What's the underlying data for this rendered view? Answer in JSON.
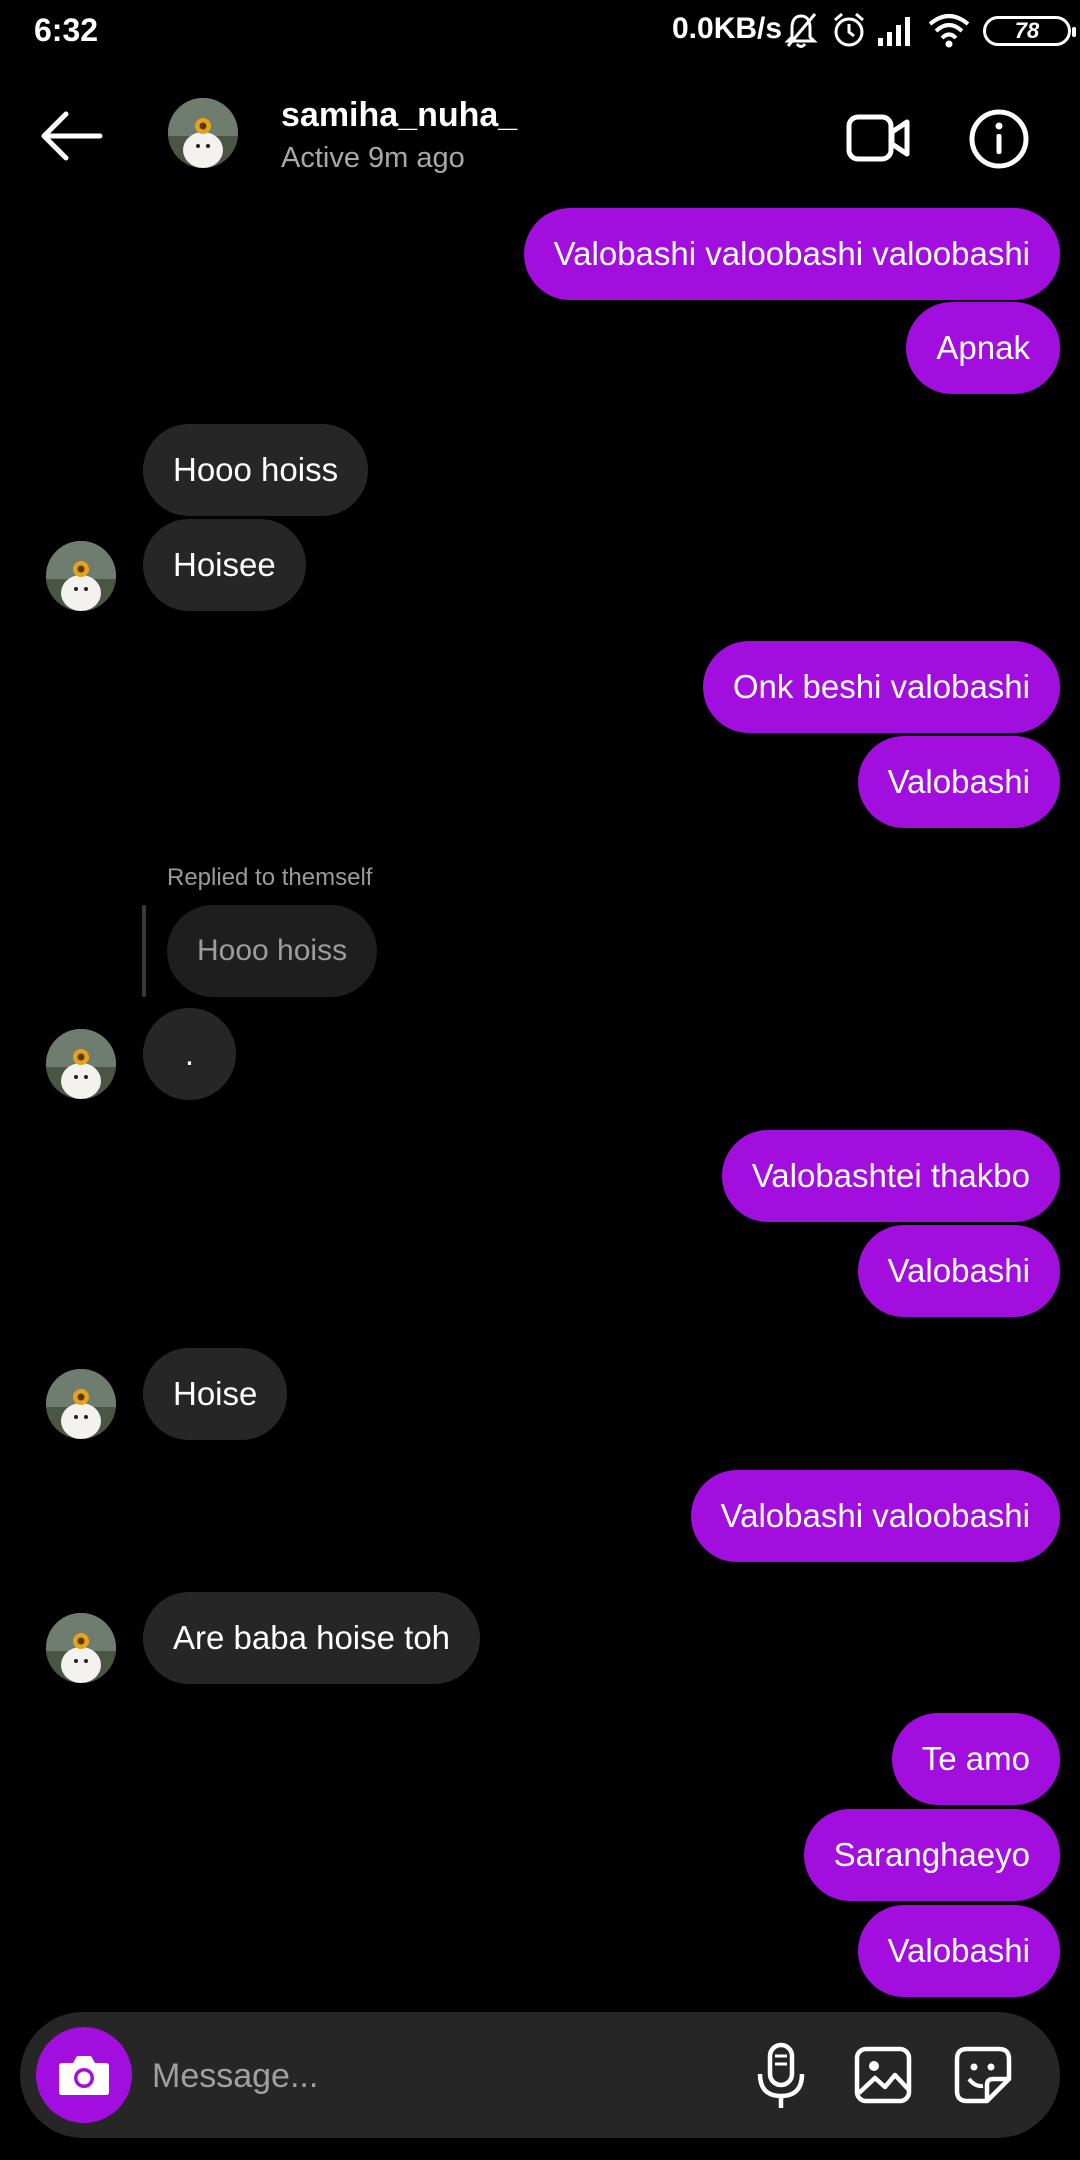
{
  "status_bar": {
    "time": "6:32",
    "net_speed": "0.0KB/s",
    "battery": "78",
    "icons": [
      "mute-bell-icon",
      "alarm-icon",
      "signal-icon",
      "wifi-icon"
    ]
  },
  "header": {
    "name": "samiha_nuha_",
    "status": "Active 9m ago",
    "icons": [
      "back-arrow-icon",
      "video-call-icon",
      "info-icon"
    ]
  },
  "messages": {
    "m1": "Valobashi valoobashi valoobashi",
    "m2": "Apnak",
    "m3": "Hooo hoiss",
    "m4": "Hoisee",
    "m5": "Onk beshi valobashi",
    "m6": "Valobashi",
    "reply_label": "Replied to themself",
    "reply_quote": "Hooo hoiss",
    "m7": ".",
    "m8": "Valobashtei thakbo",
    "m9": "Valobashi",
    "m10": "Hoise",
    "m11": "Valobashi valoobashi",
    "m12": "Are baba hoise toh",
    "m13": "Te amo",
    "m14": "Saranghaeyo",
    "m15": "Valobashi"
  },
  "composer": {
    "placeholder": "Message...",
    "icons": [
      "camera-icon",
      "microphone-icon",
      "gallery-icon",
      "sticker-icon"
    ]
  },
  "colors": {
    "sent_bubble": "#a10ede",
    "received_bubble": "#262626",
    "background": "#000000"
  }
}
